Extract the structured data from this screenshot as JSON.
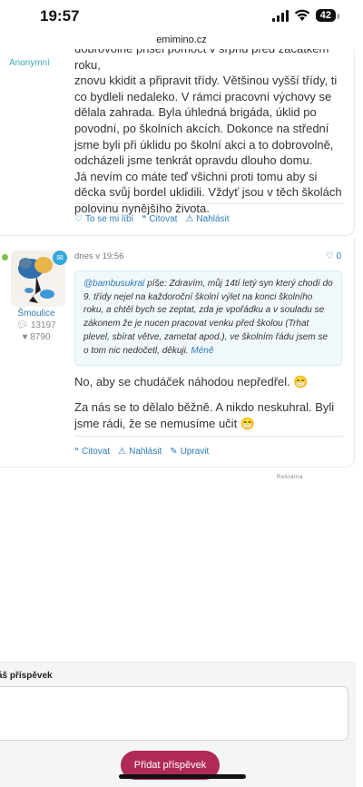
{
  "status_bar": {
    "time": "19:57",
    "battery": "42"
  },
  "browser": {
    "url": "emimino.cz"
  },
  "post1": {
    "author": "Anonymní",
    "lines_clipped": "dobrovolně přišel pomoct v srpnu před začátkem roku,",
    "paragraph1": "znovu kkidit a připravit třídy. Většinou vyšší třídy, ti co bydleli nedaleko. V rámci pracovní výchovy se dělala zahrada. Byla úhledná brigáda, úklid po povodní, po školních akcích. Dokonce na střední jsme byli při úklidu po školní akci a to dobrovolně, odcházeli jsme tenkrát opravdu dlouho domu.",
    "paragraph2": "Já nevím co máte teď všichni proti tomu aby si děcka svůj bordel uklidili. Vždyť jsou v těch školách polovinu nynějšího života.",
    "actions": {
      "like": "To se mi líbí",
      "quote": "Citovat",
      "report": "Nahlásit"
    }
  },
  "post2": {
    "username": "Šmoulice",
    "posts_count": "13197",
    "likes_count": "8790",
    "date": "dnes v 19:56",
    "like_count": "0",
    "quote": {
      "author": "@bambusukral",
      "wrote": " píše: ",
      "text": "Zdravím, můj 14tí letý syn který chodí do 9. třídy nejel na každoroční školní výlet na konci školního roku, a chtěl bych se zeptat, zda je vpořádku a v souladu se zákonem že je nucen pracovat venku před školou (Trhat plevel, sbírat větve, zametat apod.), ve školním řádu jsem se o tom nic nedočetl, děkuji. ",
      "less": "Méně"
    },
    "text1": "No, aby se chudáček náhodou nepředřel. 😁",
    "text2": "Za nás se to dělalo běžně. A nikdo neskuhral. Byli jsme rádi, že se nemusíme učit 😁",
    "actions": {
      "quote": "Citovat",
      "report": "Nahlásit",
      "edit": "Upravit"
    }
  },
  "ad_label": "Reklama",
  "composer": {
    "label": "áš příspěvek",
    "submit": "Přidat příspěvek"
  }
}
